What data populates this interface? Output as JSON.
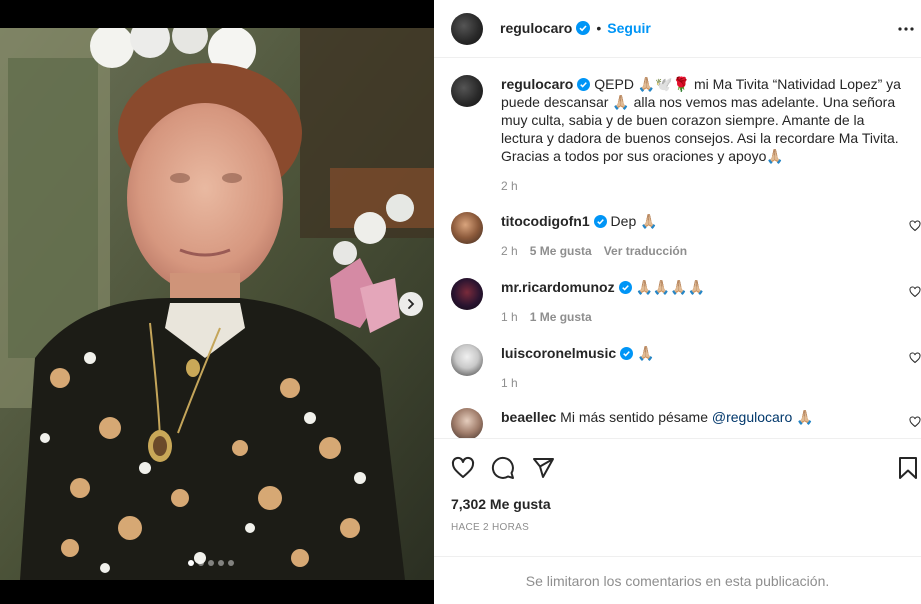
{
  "post": {
    "author": "regulocaro",
    "separator": "•",
    "follow_label": "Seguir",
    "caption": "QEPD 🙏🏼🕊️🌹 mi Ma Tivita “Natividad Lopez” ya puede descansar 🙏🏼 alla nos vemos mas adelante. Una señora muy culta, sabia y de buen corazon siempre. Amante de la lectura y dadora de buenos consejos. Asi la recordare Ma Tivita. Gracias a todos por sus oraciones y apoyo🙏🏼",
    "caption_time": "2 h"
  },
  "comments": [
    {
      "user": "titocodigofn1",
      "text": "Dep 🙏🏼",
      "time": "2 h",
      "likes": "5 Me gusta",
      "translate": "Ver traducción"
    },
    {
      "user": "mr.ricardomunoz",
      "text": "🙏🏼🙏🏼🙏🏼🙏🏼",
      "time": "1 h",
      "likes": "1 Me gusta"
    },
    {
      "user": "luiscoronelmusic",
      "text": "🙏🏼",
      "time": "1 h"
    },
    {
      "user": "beaellec",
      "text": "Mi más sentido pésame ",
      "mention": "@regulocaro",
      "text_after": " 🙏🏼"
    }
  ],
  "footer": {
    "likes": "7,302 Me gusta",
    "time_ago": "HACE 2 HORAS",
    "comments_limited": "Se limitaron los comentarios en esta publicación."
  },
  "colors": {
    "accent": "#0095f6",
    "verified": "#0095f6",
    "muted": "#8e8e8e",
    "text": "#262626"
  },
  "icons": [
    "verified-badge-icon",
    "more-options-icon",
    "heart-icon",
    "comment-icon",
    "share-icon",
    "bookmark-icon",
    "chevron-right-icon"
  ],
  "carousel": {
    "count": 5,
    "active": 1
  }
}
